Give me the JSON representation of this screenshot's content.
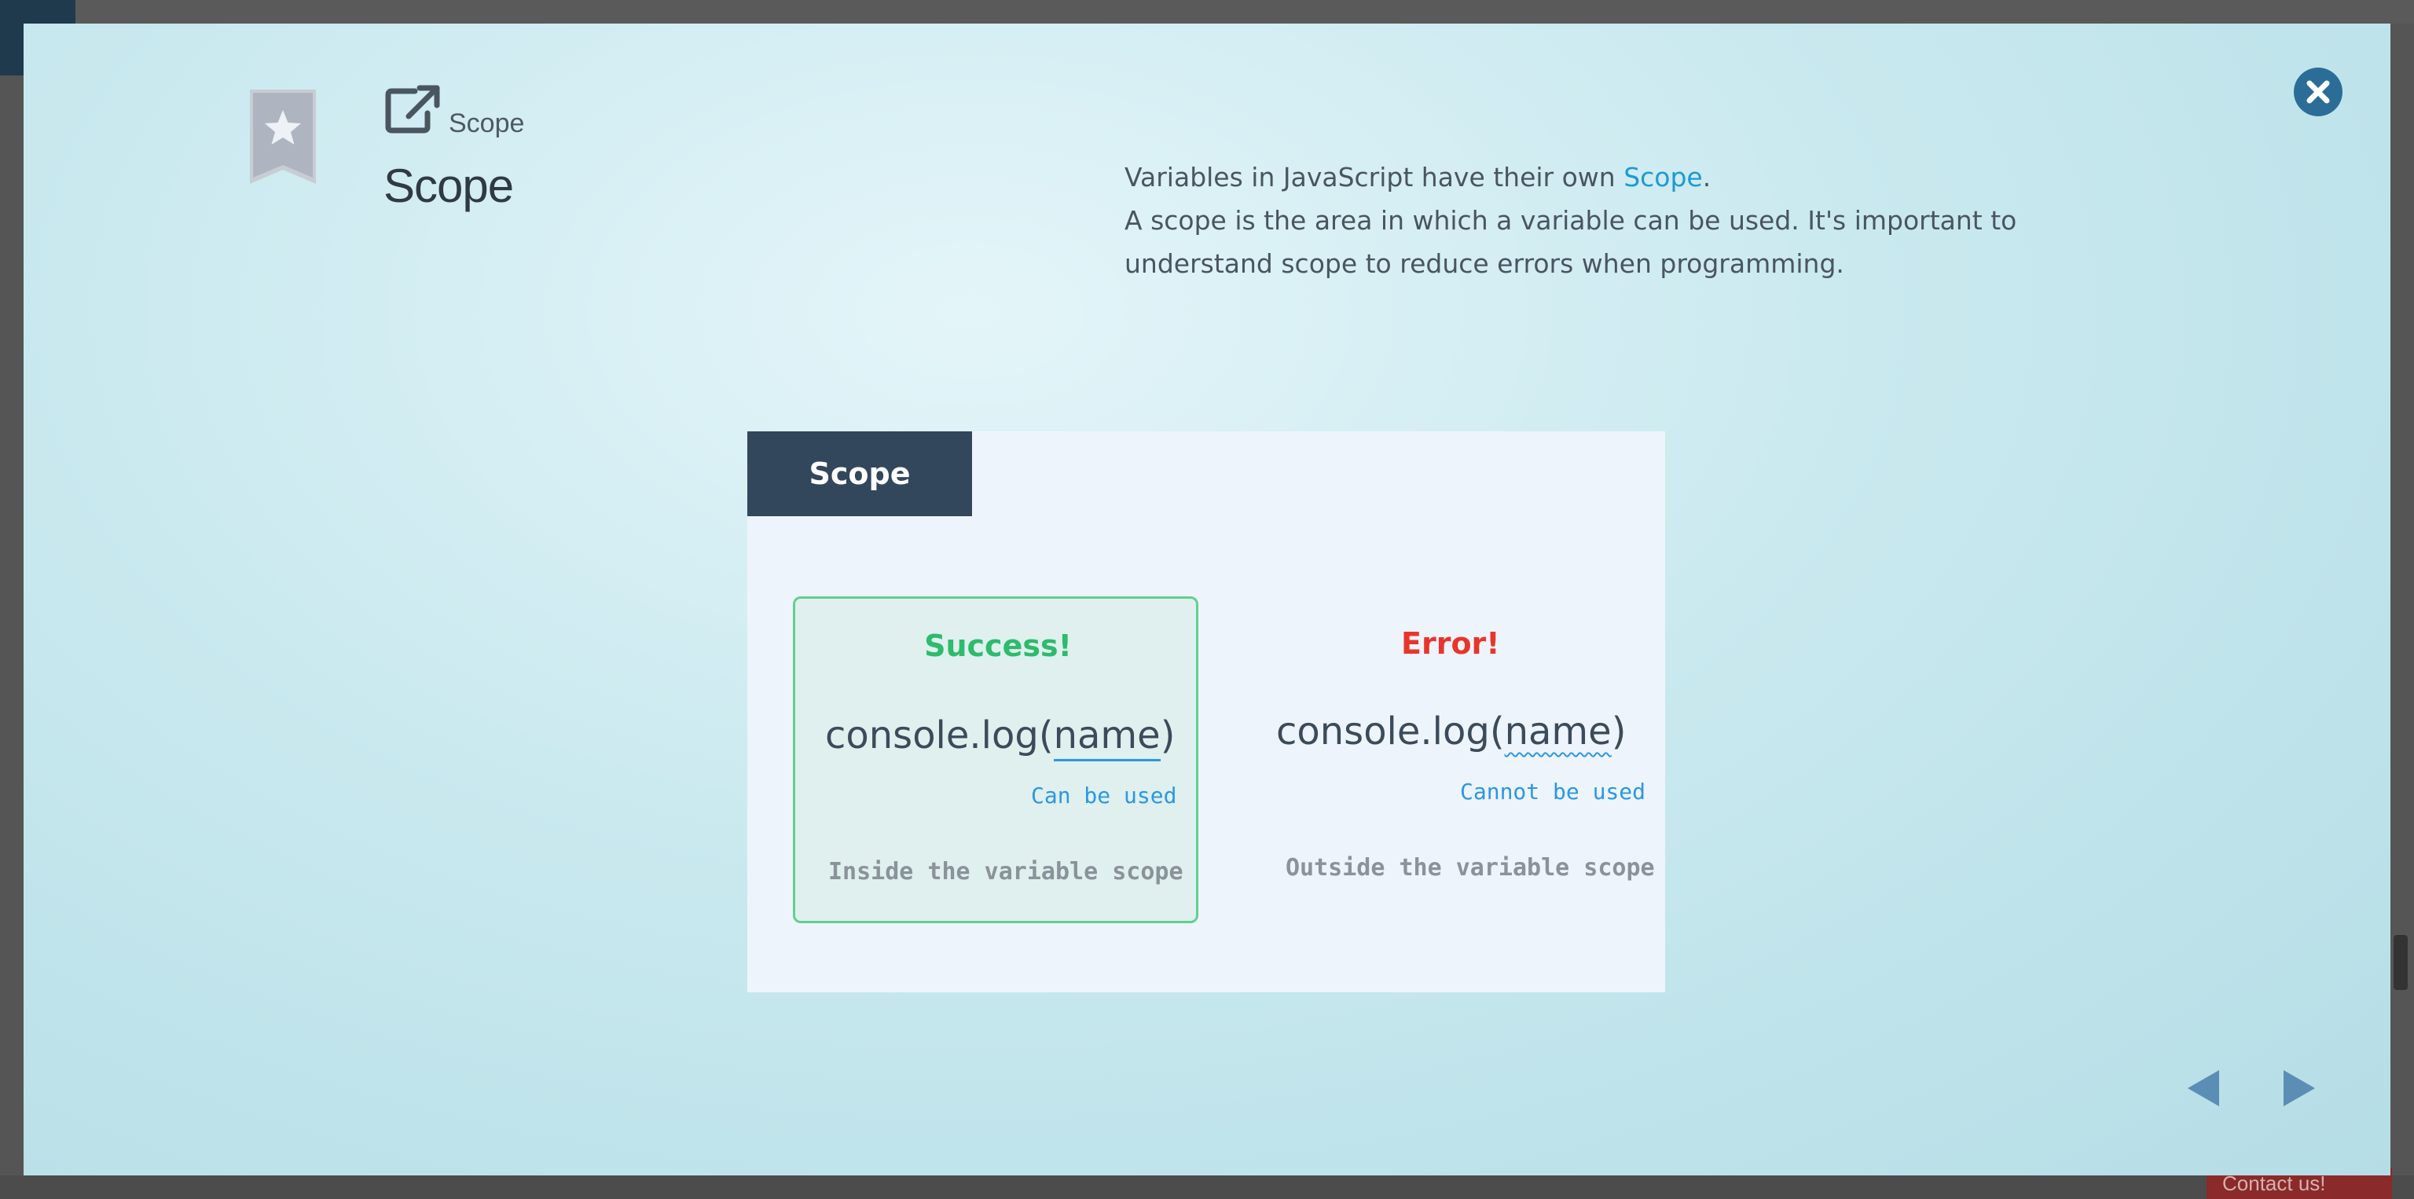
{
  "background": {
    "contact_label": "Contact us!"
  },
  "header": {
    "breadcrumb": "Scope",
    "title": "Scope"
  },
  "description": {
    "line1_prefix": "Variables in JavaScript have their own ",
    "line1_highlight": "Scope",
    "line1_suffix": ".",
    "line2": "A scope is the area in which a variable can be used. It's important to understand scope to reduce errors when programming."
  },
  "figure": {
    "tab_label": "Scope",
    "success": {
      "heading": "Success!",
      "code_prefix": "console.log(",
      "code_var": "name",
      "code_suffix": ")",
      "note": "Can be used",
      "caption": "Inside the variable scope"
    },
    "error": {
      "heading": "Error!",
      "code_prefix": "console.log(",
      "code_var": "name",
      "code_suffix": ")",
      "note": "Cannot be used",
      "caption": "Outside the variable scope"
    }
  },
  "colors": {
    "accent": "#1e9ad0",
    "success": "#2dbb6c",
    "error": "#e8352c",
    "tab_bg": "#33475c",
    "close_bg": "#2c6d98",
    "nav_arrow": "#5b8db5"
  },
  "icons": {
    "bookmark": "bookmark-star-icon",
    "external_link": "external-link-icon",
    "close": "close-icon",
    "prev": "arrow-left-icon",
    "next": "arrow-right-icon"
  }
}
